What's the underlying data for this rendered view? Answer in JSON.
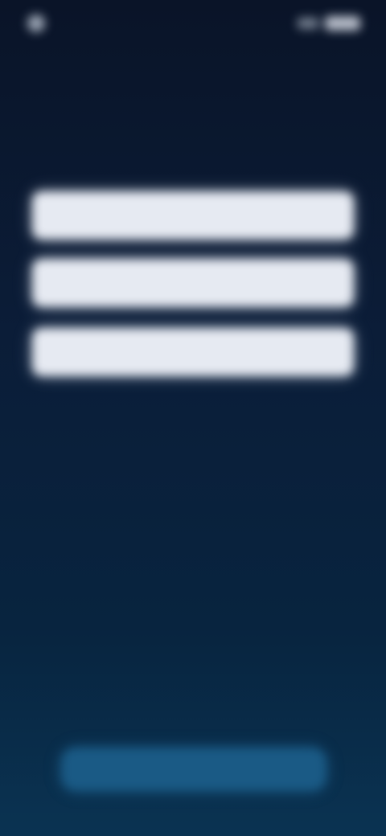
{
  "status_bar": {
    "time": "",
    "left_icon": "dot-icon",
    "right_icons": [
      "signal-icon",
      "battery-icon"
    ]
  },
  "screen": {
    "headline": "",
    "subline": ""
  },
  "form": {
    "fields": [
      {
        "placeholder": "",
        "value": ""
      },
      {
        "placeholder": "",
        "value": ""
      },
      {
        "placeholder": "",
        "value": ""
      }
    ]
  },
  "footer": {
    "text": "",
    "button_label": ""
  },
  "colors": {
    "background_top": "#0a1428",
    "background_bottom": "#0a3352",
    "field_fill": "#e6eaf2",
    "button_fill": "#1a5a85"
  }
}
